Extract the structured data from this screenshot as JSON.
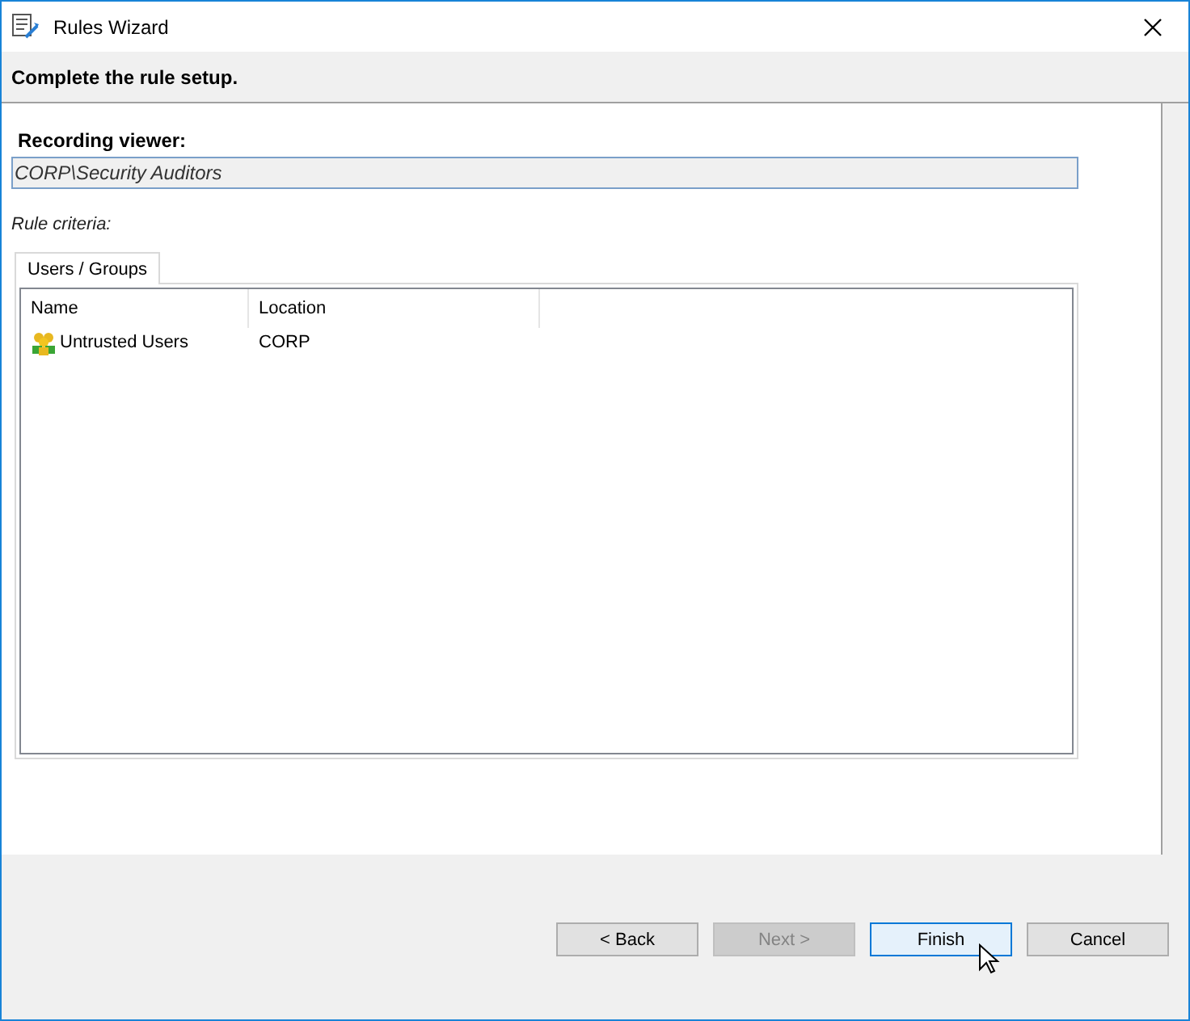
{
  "window": {
    "title": "Rules Wizard"
  },
  "header": "Complete the rule setup.",
  "recording_viewer": {
    "label": "Recording viewer:",
    "value": "CORP\\Security Auditors"
  },
  "rule_criteria": "Rule criteria:",
  "tabs": [
    {
      "label": "Users / Groups",
      "selected": true
    }
  ],
  "list": {
    "columns": [
      "Name",
      "Location"
    ],
    "rows": [
      {
        "name": "Untrusted Users",
        "location": "CORP",
        "selected": false
      }
    ]
  },
  "buttons": [
    {
      "label": "< Back",
      "disabled": false,
      "focused": false
    },
    {
      "label": "Next >",
      "disabled": true,
      "focused": false
    },
    {
      "label": "Finish",
      "disabled": false,
      "focused": true
    },
    {
      "label": "Cancel",
      "disabled": false,
      "focused": false
    }
  ]
}
